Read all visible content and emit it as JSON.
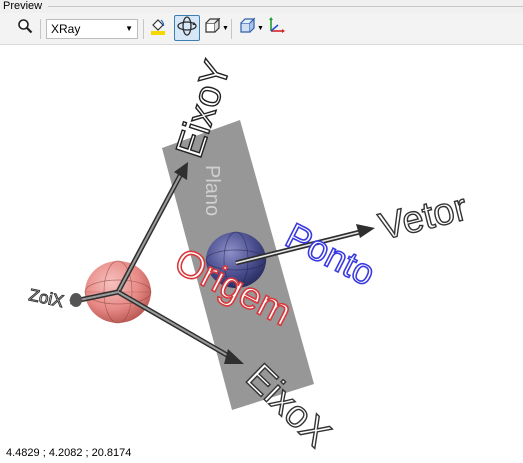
{
  "panel": {
    "title": "Preview"
  },
  "toolbar": {
    "render_mode_value": "XRay",
    "render_mode_options": [
      "XRay"
    ]
  },
  "scene": {
    "plane_label": "Plano",
    "axis_y_label": "EixoY",
    "axis_x_label": "EixoX",
    "axis_z_label": "ZoiX",
    "origin_label": "Origem",
    "point_label": "Ponto",
    "vector_label": "Vetor"
  },
  "status": {
    "coordinates": "4.4829 ; 4.2082 ; 20.8174"
  },
  "colors": {
    "origin_sphere": "#e88a86",
    "point_sphere": "#4a4e8e",
    "origin_label": "#d9383c",
    "point_label": "#3a3ae0",
    "plane": "#8c8c8c",
    "highlight_pressed": "#d6e8f7"
  }
}
